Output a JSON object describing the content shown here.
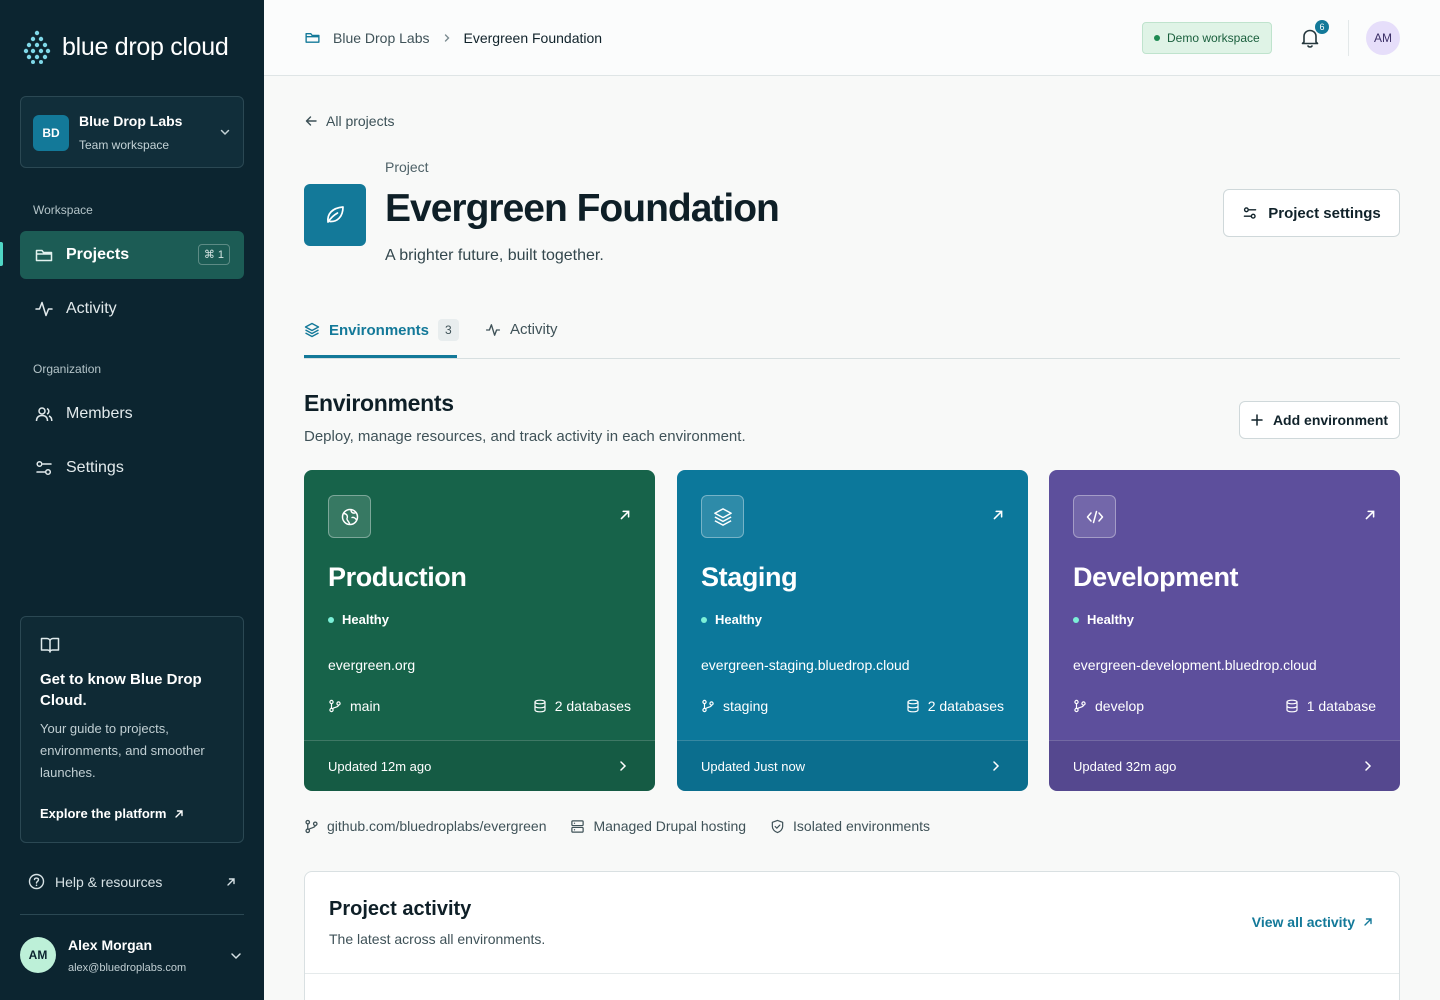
{
  "brand": {
    "name": "blue drop cloud"
  },
  "workspace": {
    "initials": "BD",
    "name": "Blue Drop Labs",
    "type": "Team workspace"
  },
  "sidebar": {
    "workspace_label": "Workspace",
    "organization_label": "Organization",
    "items": [
      {
        "label": "Projects",
        "shortcut": "⌘ 1",
        "active": true
      },
      {
        "label": "Activity"
      },
      {
        "label": "Members"
      },
      {
        "label": "Settings"
      }
    ],
    "guide": {
      "title": "Get to know Blue Drop Cloud.",
      "body": "Your guide to projects, environments, and smoother launches.",
      "link": "Explore the platform"
    },
    "help": "Help & resources",
    "user": {
      "initials": "AM",
      "name": "Alex Morgan",
      "email": "alex@bluedroplabs.com"
    }
  },
  "header": {
    "breadcrumb": [
      "Blue Drop Labs",
      "Evergreen Foundation"
    ],
    "demo_badge": "Demo workspace",
    "notification_count": "6",
    "avatar_initials": "AM"
  },
  "project": {
    "back_label": "All projects",
    "kicker": "Project",
    "title": "Evergreen Foundation",
    "description": "A brighter future, built together.",
    "settings_label": "Project settings"
  },
  "tabs": [
    {
      "label": "Environments",
      "count": "3",
      "active": true
    },
    {
      "label": "Activity"
    }
  ],
  "environments_section": {
    "title": "Environments",
    "subtitle": "Deploy, manage resources, and track activity in each environment.",
    "add_label": "Add environment"
  },
  "environments": [
    {
      "name": "Production",
      "status": "Healthy",
      "domain": "evergreen.org",
      "branch": "main",
      "databases": "2 databases",
      "updated": "Updated 12m ago",
      "color": "#17634a"
    },
    {
      "name": "Staging",
      "status": "Healthy",
      "domain": "evergreen-staging.bluedrop.cloud",
      "branch": "staging",
      "databases": "2 databases",
      "updated": "Updated Just now",
      "color": "#0c789b"
    },
    {
      "name": "Development",
      "status": "Healthy",
      "domain": "evergreen-development.bluedrop.cloud",
      "branch": "develop",
      "databases": "1 database",
      "updated": "Updated 32m ago",
      "color": "#5d4f9c"
    }
  ],
  "meta": {
    "repo": "github.com/bluedroplabs/evergreen",
    "hosting": "Managed Drupal hosting",
    "isolation": "Isolated environments"
  },
  "activity": {
    "title": "Project activity",
    "subtitle": "The latest across all environments.",
    "view_all": "View all activity"
  }
}
